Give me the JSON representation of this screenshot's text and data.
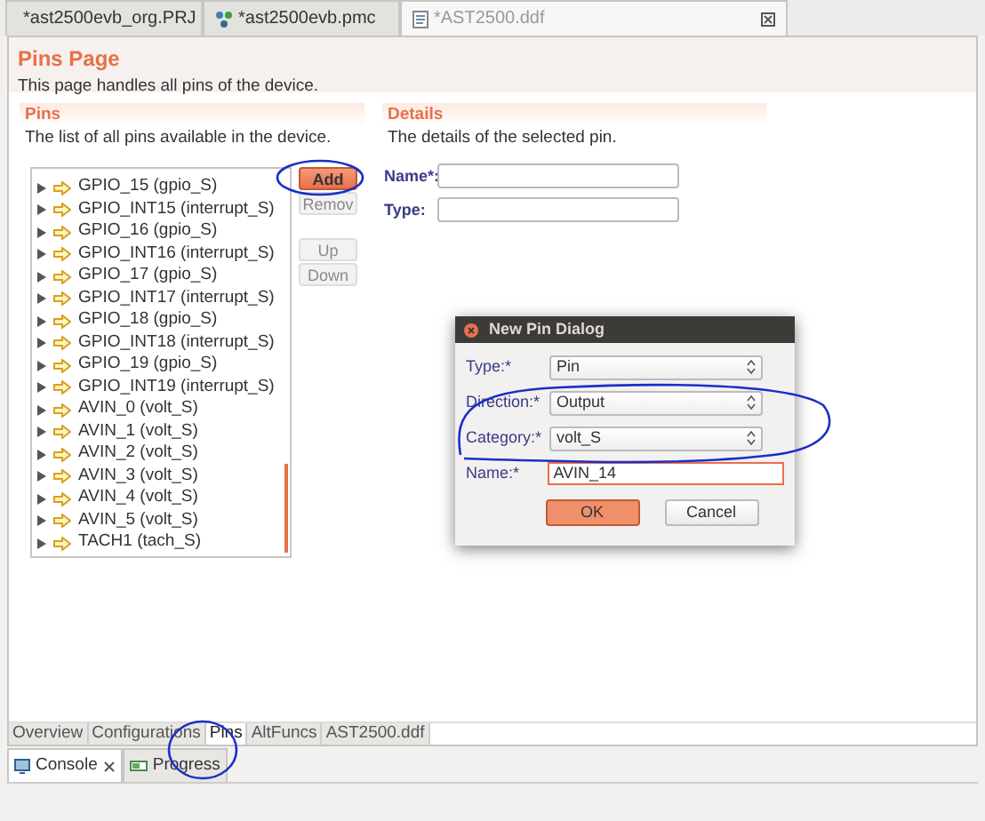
{
  "editor_tabs": [
    {
      "label": "*ast2500evb_org.PRJ",
      "selected": false
    },
    {
      "label": "*ast2500evb.pmc",
      "selected": false
    },
    {
      "label": "*AST2500.ddf",
      "selected": true
    }
  ],
  "page": {
    "title": "Pins Page",
    "description": "This page handles all pins of the device."
  },
  "pins_section": {
    "title": "Pins",
    "description": "The list of all pins available in the device.",
    "pins": [
      "GPIO_15 (gpio_S)",
      "GPIO_INT15 (interrupt_S)",
      "GPIO_16 (gpio_S)",
      "GPIO_INT16 (interrupt_S)",
      "GPIO_17 (gpio_S)",
      "GPIO_INT17 (interrupt_S)",
      "GPIO_18 (gpio_S)",
      "GPIO_INT18 (interrupt_S)",
      "GPIO_19 (gpio_S)",
      "GPIO_INT19 (interrupt_S)",
      "AVIN_0 (volt_S)",
      "AVIN_1 (volt_S)",
      "AVIN_2 (volt_S)",
      "AVIN_3 (volt_S)",
      "AVIN_4 (volt_S)",
      "AVIN_5 (volt_S)",
      "TACH1 (tach_S)"
    ],
    "buttons": [
      {
        "label": "Add",
        "disabled": false
      },
      {
        "label": "Remov",
        "disabled": true
      },
      {
        "label": "Up",
        "disabled": true
      },
      {
        "label": "Down",
        "disabled": true
      }
    ]
  },
  "details_section": {
    "title": "Details",
    "description": "The details of the selected pin.",
    "fields": [
      {
        "label": "Name*:"
      },
      {
        "label": "Type:"
      }
    ]
  },
  "dialog": {
    "title": "New Pin Dialog",
    "fields": [
      {
        "label": "Type:*",
        "kind": "select",
        "value": "Pin"
      },
      {
        "label": "Direction:*",
        "kind": "select",
        "value": "Output"
      },
      {
        "label": "Category:*",
        "kind": "select",
        "value": "volt_S"
      },
      {
        "label": "Name:*",
        "kind": "text",
        "value": "AVIN_14"
      }
    ],
    "buttons": [
      {
        "label": "OK",
        "primary": true
      },
      {
        "label": "Cancel",
        "primary": false
      }
    ]
  },
  "page_tabs": [
    {
      "label": "Overview",
      "selected": false
    },
    {
      "label": "Configurations",
      "selected": false
    },
    {
      "label": "Pins",
      "selected": true
    },
    {
      "label": "AltFuncs",
      "selected": false
    },
    {
      "label": "AST2500.ddf",
      "selected": false
    }
  ],
  "bottom_views": [
    {
      "label": "Console",
      "selected": true
    },
    {
      "label": "Progress",
      "selected": false
    }
  ]
}
